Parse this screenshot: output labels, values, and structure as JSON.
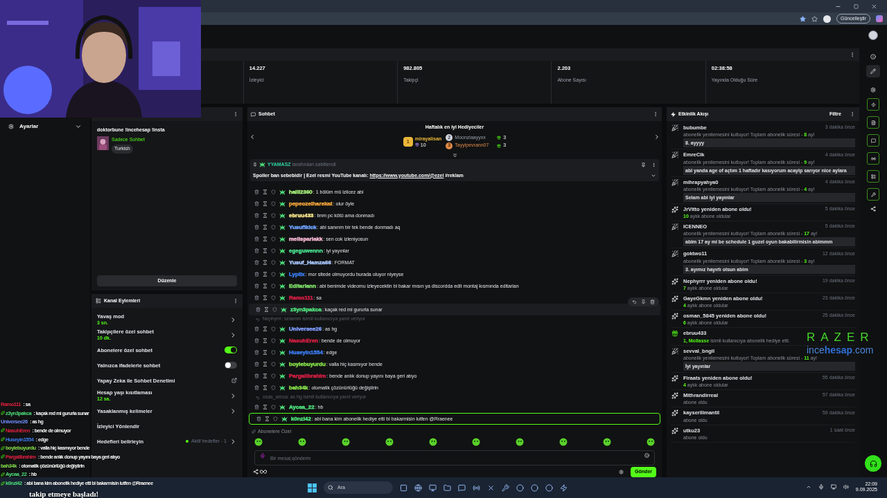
{
  "browser": {
    "update_button": "Güncelleştir"
  },
  "stats": [
    {
      "value": "14.227",
      "label": "İzleyici"
    },
    {
      "value": "982.805",
      "label": "Takipçi"
    },
    {
      "value": "2.203",
      "label": "Abone Sayısı"
    },
    {
      "value": "02:38:58",
      "label": "Yayında Olduğu Süre"
    }
  ],
  "sidebar": {
    "title": "Ayarlar"
  },
  "stream_info": {
    "title": "doktorbune !incehesap !insta",
    "category": "Sadece Sohbet",
    "tag": "Turkish",
    "edit_button": "Düzenle"
  },
  "channel_actions": {
    "title": "Kanal Eylemleri",
    "items": [
      {
        "kind": "link",
        "label": "Yavaş mod",
        "value": "3 sn."
      },
      {
        "kind": "link",
        "label": "Takipçilere özel sohbet",
        "value": "10 dk."
      },
      {
        "kind": "toggle",
        "label": "Abonelere özel sohbet",
        "on": true
      },
      {
        "kind": "toggle",
        "label": "Yalnızca ifadelerle sohbet",
        "on": false
      },
      {
        "kind": "external",
        "label": "Yapay Zeka ile Sohbet Denetimi"
      },
      {
        "kind": "link",
        "label": "Hesap yaşı kısıtlaması",
        "value": "12 sa."
      },
      {
        "kind": "link",
        "label": "Yasaklanmış kelimeler"
      },
      {
        "kind": "plain",
        "label": "İzleyici Yönlendir"
      },
      {
        "kind": "goal",
        "label": "Hedefleri belirleyin",
        "value": "Aktif hedefler - 1"
      }
    ]
  },
  "chat": {
    "title": "Sohbet",
    "gifters_title": "Haftalık en iyi Hediyeciler",
    "gifters": [
      {
        "rank": "1",
        "name": "mirayalisan",
        "count": "10"
      },
      {
        "rank": "2",
        "name": "Moonziaayyxx",
        "count": "3"
      },
      {
        "rank": "3",
        "name": "Tayyipevrann07",
        "count": "3"
      }
    ],
    "pinned": {
      "by": "YYAMASZ",
      "by_suffix": "tarafından sabitlendi",
      "text": "Spoiler ban sebebidir | Ezel resmi YouTube kanalı: ",
      "link": "https://www.youtube.com/@ezel",
      "text_after": " #reklam"
    },
    "messages": [
      {
        "kind": "message",
        "user": "halil2360",
        "color": "#a6f07a",
        "text": ": 1 bölüm mü izlicez abi",
        "hovered": false,
        "mention": false
      },
      {
        "kind": "message",
        "user": "pepeozelharekat",
        "color": "#eda13a",
        "text": ": olur öyle",
        "hovered": false,
        "mention": false
      },
      {
        "kind": "message",
        "user": "ebruu433",
        "color": "#f3e28a",
        "text": ": bnm pc kötü ama donmadı",
        "hovered": false,
        "mention": false
      },
      {
        "kind": "message",
        "user": "Yusufikick",
        "color": "#6fa3ff",
        "text": ": abi sanırım bir tek bende donmadı aq",
        "hovered": false,
        "mention": false
      },
      {
        "kind": "message",
        "user": "melisparlakk",
        "color": "#f5b5d0",
        "text": ": sen cok izleniyosun",
        "hovered": false,
        "mention": false
      },
      {
        "kind": "message",
        "user": "egeguwennn",
        "color": "#47d98a",
        "text": ": iyi yayınlar",
        "hovered": false,
        "mention": false
      },
      {
        "kind": "message",
        "user": "Yusuf_Hamza66",
        "color": "#a9c8ff",
        "text": ": FORMAT",
        "hovered": false,
        "mention": false
      },
      {
        "kind": "message",
        "user": "Lyplix",
        "color": "#3b7cf0",
        "text": ": mor sitede olmuyordu burada oluyor niyeyse",
        "hovered": false,
        "mention": false
      },
      {
        "kind": "message",
        "user": "Editariann",
        "color": "#7fe06a",
        "text": ": abi benimde videomu izleyecektin bi bakar mısın ya discordda edit montaj kısmında editarian",
        "hovered": false,
        "mention": false
      },
      {
        "kind": "message",
        "user": "Ramo111",
        "color": "#d61f45",
        "text": ": sa",
        "hovered": false,
        "mention": false
      },
      {
        "kind": "message",
        "user": "z3yn3pakca",
        "color": "#4ee07c",
        "text": ": kaçak red mi gururla sunar",
        "hovered": true,
        "mention": false
      },
      {
        "kind": "reply",
        "text": "Nephyrrr: selamm isimli kullanıcıya yanıt veriyor"
      },
      {
        "kind": "message",
        "user": "Universee26",
        "color": "#7f9cff",
        "text": ": as hg",
        "hovered": false,
        "mention": false
      },
      {
        "kind": "message",
        "user": "NasuhEren",
        "color": "#d61f45",
        "text": ": bende de olmuyor",
        "hovered": false,
        "mention": false
      },
      {
        "kind": "message",
        "user": "Huseyin1554",
        "color": "#3b7cf0",
        "text": ": edge",
        "hovered": false,
        "mention": false
      },
      {
        "kind": "message",
        "user": "boylebuyurdu",
        "color": "#86e04a",
        "text": ": valla hiç kasmıyor bende",
        "hovered": false,
        "mention": false
      },
      {
        "kind": "message",
        "user": "Pargalibrahim",
        "color": "#d61f45",
        "text": ": bende anlık donup yayını baya geri atıyo",
        "hovered": false,
        "mention": false
      },
      {
        "kind": "message",
        "user": "bah34k",
        "color": "#86e04a",
        "text": ": otomatik çözünürlüğü değiştirin",
        "hovered": false,
        "mention": false
      },
      {
        "kind": "reply",
        "text": "osas_amca: as hg isimli kullanıcıya yanıt veriyor"
      },
      {
        "kind": "message",
        "user": "Aycaa_22",
        "color": "#4ee07c",
        "text": ": hb",
        "hovered": false,
        "mention": false
      },
      {
        "kind": "message",
        "user": "k0nzi42",
        "color": "#4ee07c",
        "text": ": abi bana kim abonelik hediye etti bi bakarmisin lutfen @Rraenee",
        "hovered": false,
        "mention": true
      }
    ],
    "subscribers_label": "Abonelere Özel",
    "input_placeholder": "Bir mesaj gönderin",
    "send_button": "Gönder"
  },
  "events": {
    "title": "Etkinlik Akışı",
    "filter_button": "Filtre",
    "items": [
      {
        "kind": "resub_message",
        "title": "bubumbe",
        "time": "3 dakika önce",
        "note_before": "abonelik yenilemesini kutluyor! Toplam abonelik süresi - ",
        "highlight": "8",
        "note_after": " ay!",
        "message": "8. ayyyy"
      },
      {
        "kind": "resub_message",
        "title": "EmreCik",
        "time": "4 dakika önce",
        "note_before": "abonelik yenilemesini kutluyor! Toplam abonelik süresi - ",
        "highlight": "9",
        "note_after": " ay!",
        "message": "abi yanda age of açtım 1 haftadır kasıyorum acayip sarıyor nice aylara"
      },
      {
        "kind": "resub_message",
        "title": "mihrapyahya0",
        "time": "4 dakika önce",
        "note_before": "abonelik yenilemesini kutluyor! Toplam abonelik süresi - ",
        "highlight": "4",
        "note_after": " ay!",
        "message": "Selam abi iyi yayınlar"
      },
      {
        "kind": "resub",
        "title": "JrVitto yeniden abone oldu!",
        "time": "5 dakika önce",
        "highlight": "10",
        "note_after": " aylık abone oldular"
      },
      {
        "kind": "resub_message",
        "title": "ICENNEO",
        "time": "5 dakika önce",
        "note_before": "abonelik yenilemesini kutluyor! Toplam abonelik süresi - ",
        "highlight": "17",
        "note_after": " ay!",
        "message": "abim 17 ay mi be schedule 1 guzel oyun bakabilirmisin abimmm"
      },
      {
        "kind": "resub_message",
        "title": "goktwo11",
        "time": "12 dakika önce",
        "note_before": "abonelik yenilemesini kutluyor! Toplam abonelik süresi - ",
        "highlight": "3",
        "note_after": " ay!",
        "message": "3. ayımız hayırlı olsun abim"
      },
      {
        "kind": "resub",
        "title": "Nephyrrr yeniden abone oldu!",
        "time": "19 dakika önce",
        "highlight": "7",
        "note_after": " aylık abone oldular"
      },
      {
        "kind": "resub",
        "title": "GayeGkmn yeniden abone oldu!",
        "time": "23 dakika önce",
        "highlight": "4",
        "note_after": " aylık abone oldular"
      },
      {
        "kind": "resub",
        "title": "osman_5845 yeniden abone oldu!",
        "time": "25 dakika önce",
        "highlight": "6",
        "note_after": " aylık abone oldular"
      },
      {
        "kind": "gift",
        "title": "ebruu433",
        "highlight": "1, Mollasse",
        "note_after": " isimli kullanıcıya abonelik hediye etti."
      },
      {
        "kind": "resub_message",
        "title": "sevval_bngil",
        "note_before": "abonelik yenilemesini kutluyor! Toplam abonelik süresi - ",
        "highlight": "11",
        "note_after": " ay!",
        "message": "İyi yayınlar"
      },
      {
        "kind": "resub",
        "title": "Firaats yeniden abone oldu!",
        "time": "55 dakika önce",
        "highlight": "4",
        "note_after": " aylık abone oldular"
      },
      {
        "kind": "sub",
        "title": "Mithrandirreal",
        "time": "57 dakika önce",
        "note_after": "abone oldu"
      },
      {
        "kind": "sub",
        "title": "kayserilimantil",
        "time": "59 dakika önce",
        "note_after": "abone oldu"
      },
      {
        "kind": "sub",
        "title": "utku23",
        "time": "1 saat önce",
        "note_after": "abone oldu"
      }
    ]
  },
  "stream_overlay": {
    "lines": [
      {
        "user": "Ramo111",
        "color": "#e0203f",
        "text": " : sa",
        "badge": false
      },
      {
        "user": "z3yn3pakca",
        "color": "#4ee07c",
        "text": " : kaçak red mi gururla sunar",
        "badge": true
      },
      {
        "user": "Universee26",
        "color": "#6f8cff",
        "text": " : as hg",
        "badge": false
      },
      {
        "user": "NasuhEren",
        "color": "#e0203f",
        "text": " : bende de olmuyor",
        "badge": true
      },
      {
        "user": "Huseyin1554",
        "color": "#3b7cf0",
        "text": " : edge",
        "badge": true
      },
      {
        "user": "boylebuyurdu",
        "color": "#86e04a",
        "text": " : valla hiç kasmıyor bende",
        "badge": true
      },
      {
        "user": "Pargalibrahim",
        "color": "#e0203f",
        "text": " : bende anlık donup yayını baya geri atıyo",
        "badge": true
      },
      {
        "user": "bah34k",
        "color": "#86e04a",
        "text": " : otomatik çözünürlüğü değiştirin",
        "badge": false
      },
      {
        "user": "Aycaa_22",
        "color": "#4ee07c",
        "text": " : hb",
        "badge": true
      },
      {
        "user": "k0nzi42",
        "color": "#4ee07c",
        "text": " : abi bana kim abonelik hediye etti bi bakarmisin lutfen @Rraenee",
        "badge": true
      }
    ],
    "alert": "takip etmeye başladı!"
  },
  "sponsor": {
    "brand": "RAZER",
    "site": "ince**hesap**.com"
  },
  "taskbar": {
    "search_placeholder": "Ara",
    "time": "22:09",
    "date": "9.09.2025"
  }
}
